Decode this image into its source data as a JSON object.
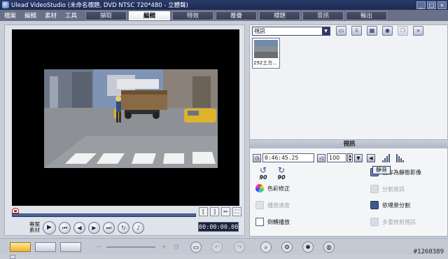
{
  "window": {
    "title": "Ulead VideoStudio (未命名標題, DVD NTSC 720*480 - 立體聲)",
    "controls": [
      "_",
      "□",
      "×"
    ]
  },
  "menu": [
    "檔案",
    "編輯",
    "素材",
    "工具"
  ],
  "steps": [
    {
      "label": "擷取",
      "active": false
    },
    {
      "label": "編輯",
      "active": true
    },
    {
      "label": "特效",
      "active": false
    },
    {
      "label": "覆疊",
      "active": false
    },
    {
      "label": "標題",
      "active": false
    },
    {
      "label": "音訊",
      "active": false
    },
    {
      "label": "輸出",
      "active": false
    }
  ],
  "preview": {
    "project_label": "專案",
    "clip_label": "素材",
    "timecode": "00:00:00.00",
    "mark_in": "[",
    "mark_out": "]"
  },
  "library": {
    "category": "視訊",
    "thumbnail_label": "292土方..."
  },
  "options": {
    "header": "視訊",
    "duration": "0:46:45.25",
    "volume": "100",
    "rotate_left": "90",
    "rotate_right": "90",
    "tooltip": "靜音",
    "items": {
      "color_correction": "色彩修正",
      "playback_speed": "播放速度",
      "reverse_video": "倒轉播放",
      "save_as_still": "儲存為靜態影像",
      "split_audio": "分割音訊",
      "split_by_scene": "依場景分割",
      "multi_trim": "多重修剪視訊"
    }
  },
  "watermark": "#1260389",
  "colors": {
    "accent": "#2d3a63",
    "active_tab": "#ffffff",
    "timeline_active": "#f0b030"
  }
}
